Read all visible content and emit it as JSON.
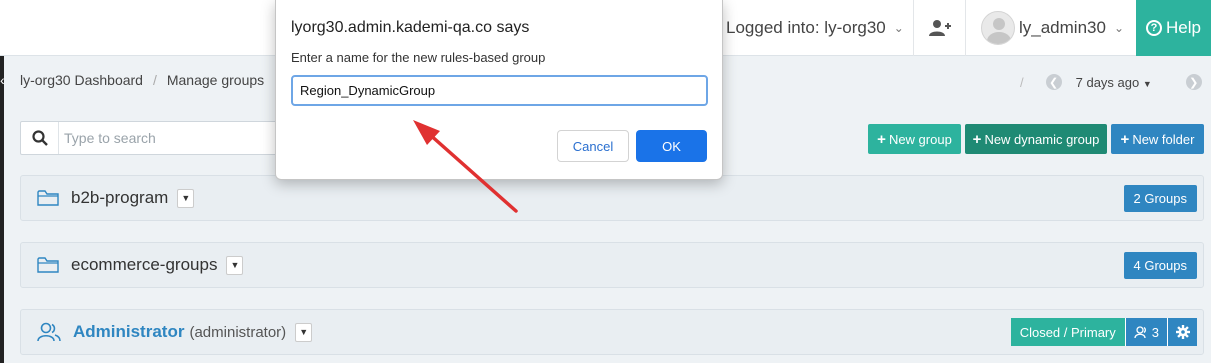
{
  "navbar": {
    "logged_into": "Logged into: ly-org30",
    "username": "ly_admin30",
    "help_label": "Help"
  },
  "breadcrumb": {
    "items": [
      "ly-org30 Dashboard",
      "Manage groups"
    ],
    "separator": "/"
  },
  "date_nav": {
    "slash": "/",
    "label": "7 days ago"
  },
  "search": {
    "placeholder": "Type to search"
  },
  "toolbar": {
    "new_group": "New group",
    "new_dynamic_group": "New dynamic group",
    "new_folder": "New folder"
  },
  "rows": [
    {
      "name": "b2b-program",
      "count": "2 Groups"
    },
    {
      "name": "ecommerce-groups",
      "count": "4 Groups"
    }
  ],
  "admin_row": {
    "name": "Administrator",
    "identifier": "(administrator)",
    "status": "Closed / Primary",
    "members": "3"
  },
  "dialog": {
    "title": "lyorg30.admin.kademi-qa.co says",
    "message": "Enter a name for the new rules-based group",
    "input_value": "Region_DynamicGroup",
    "cancel": "Cancel",
    "ok": "OK"
  },
  "colors": {
    "teal": "#2db39e",
    "dark_teal": "#1f8a74",
    "blue": "#2f86c1",
    "dialog_ok": "#1a73e8",
    "arrow": "#e03131"
  }
}
